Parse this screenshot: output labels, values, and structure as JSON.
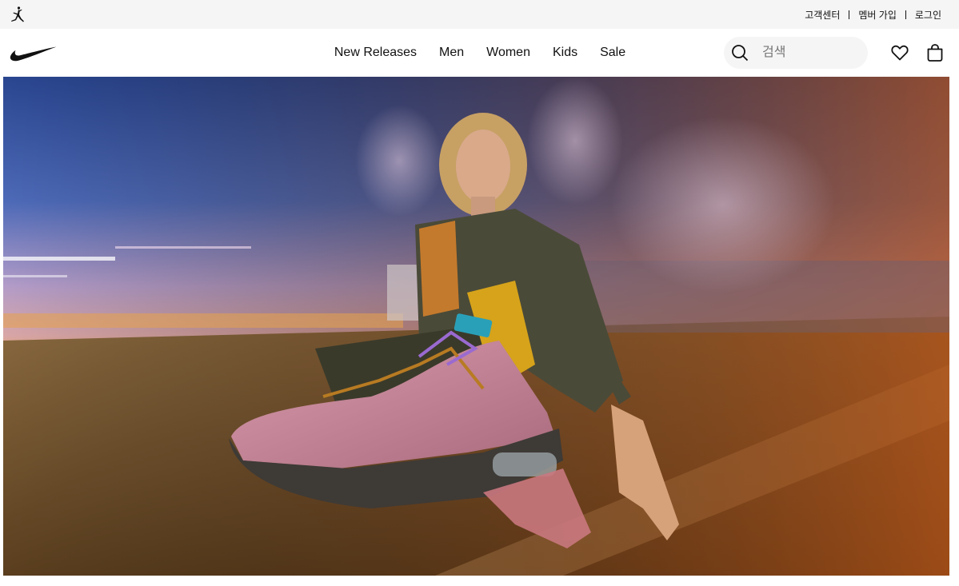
{
  "utility_bar": {
    "brand_icon": "jordan-jumpman-icon",
    "links": [
      {
        "label": "고객센터"
      },
      {
        "label": "멤버 가입"
      },
      {
        "label": "로그인"
      }
    ]
  },
  "nav": {
    "logo_icon": "nike-swoosh-icon",
    "menu": [
      {
        "label": "New Releases"
      },
      {
        "label": "Men"
      },
      {
        "label": "Women"
      },
      {
        "label": "Kids"
      },
      {
        "label": "Sale"
      }
    ],
    "search": {
      "placeholder": "검색",
      "value": ""
    },
    "favorites_icon": "heart-icon",
    "bag_icon": "shopping-bag-icon"
  },
  "hero": {
    "image": "sneaker-campaign-photo",
    "colors": {
      "sky_top": "#2f4f9c",
      "sky_mid": "#c9a9c9",
      "horizon": "#e7a24a",
      "ground": "#7a5a2e",
      "shoe_pink": "#c98a9b",
      "sock_yellow": "#d6a31a",
      "jacket": "#4a4a38"
    }
  },
  "theme": {
    "utility_bg": "#f5f5f5",
    "text": "#111111",
    "search_bg": "#f5f5f5"
  }
}
